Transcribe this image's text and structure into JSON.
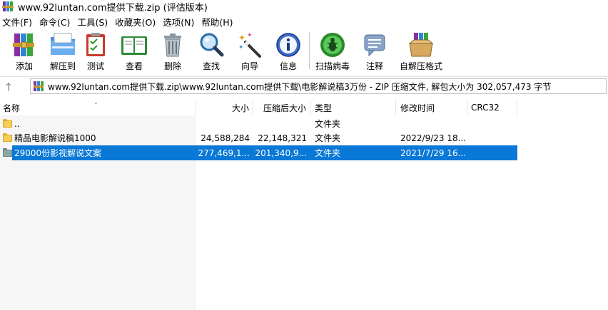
{
  "window": {
    "title": "www.92luntan.com提供下载.zip (评估版本)",
    "icon": "winrar-books-icon"
  },
  "menu": [
    {
      "label": "文件(F)"
    },
    {
      "label": "命令(C)"
    },
    {
      "label": "工具(S)"
    },
    {
      "label": "收藏夹(O)"
    },
    {
      "label": "选项(N)"
    },
    {
      "label": "帮助(H)"
    }
  ],
  "toolbar": {
    "buttons": [
      {
        "label": "添加",
        "icon": "add-archive-icon"
      },
      {
        "label": "解压到",
        "icon": "extract-to-icon"
      },
      {
        "label": "测试",
        "icon": "test-clipboard-icon"
      },
      {
        "label": "查看",
        "icon": "view-book-icon"
      },
      {
        "label": "删除",
        "icon": "delete-trash-icon"
      },
      {
        "label": "查找",
        "icon": "find-magnifier-icon"
      },
      {
        "label": "向导",
        "icon": "wizard-wand-icon"
      },
      {
        "label": "信息",
        "icon": "info-icon"
      },
      {
        "label": "扫描病毒",
        "icon": "virus-scan-icon"
      },
      {
        "label": "注释",
        "icon": "comment-icon"
      },
      {
        "label": "自解压格式",
        "icon": "sfx-box-icon"
      }
    ]
  },
  "address": {
    "path": "www.92luntan.com提供下载.zip\\www.92luntan.com提供下载\\电影解说稿3万份 - ZIP 压缩文件, 解包大小为 302,057,473 字节"
  },
  "columns": {
    "name": "名称",
    "size": "大小",
    "packed": "压缩后大小",
    "type": "类型",
    "modified": "修改时间",
    "crc": "CRC32"
  },
  "rows": [
    {
      "name": "..",
      "size": "",
      "packed": "",
      "type": "文件夹",
      "modified": "",
      "crc": ""
    },
    {
      "name": "精品电影解说稿1000",
      "size": "24,588,284",
      "packed": "22,148,321",
      "type": "文件夹",
      "modified": "2022/9/23 18...",
      "crc": ""
    },
    {
      "name": "29000份影视解说文案",
      "size": "277,469,1...",
      "packed": "201,340,9...",
      "type": "文件夹",
      "modified": "2021/7/29 16...",
      "crc": ""
    }
  ],
  "colors": {
    "selection": "#0a78d7"
  }
}
